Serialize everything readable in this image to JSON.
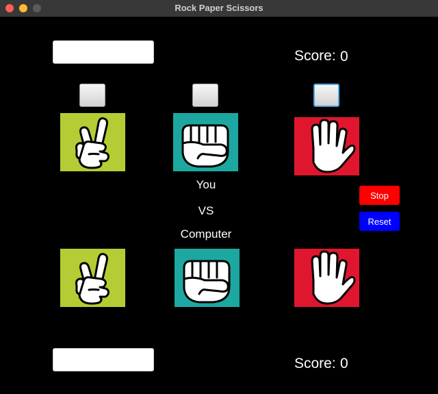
{
  "window": {
    "title": "Rock Paper Scissors"
  },
  "player": {
    "name_value": "",
    "score_label": "Score:",
    "score_value": "0"
  },
  "computer": {
    "name_value": "",
    "score_label": "Score:",
    "score_value": "0"
  },
  "center": {
    "line1": "You",
    "line2": "VS",
    "line3": "Computer"
  },
  "buttons": {
    "stop_label": "Stop",
    "reset_label": "Reset"
  },
  "choices": [
    {
      "name": "scissors",
      "icon": "scissors-hand-icon",
      "color": "#b6cc34"
    },
    {
      "name": "rock",
      "icon": "rock-fist-icon",
      "color": "#1ca8a0"
    },
    {
      "name": "paper",
      "icon": "paper-hand-icon",
      "color": "#e0162f"
    }
  ],
  "colors": {
    "background": "#000000",
    "stop": "#ff0000",
    "reset": "#0000ff",
    "focus_ring": "#4aa8e6"
  }
}
